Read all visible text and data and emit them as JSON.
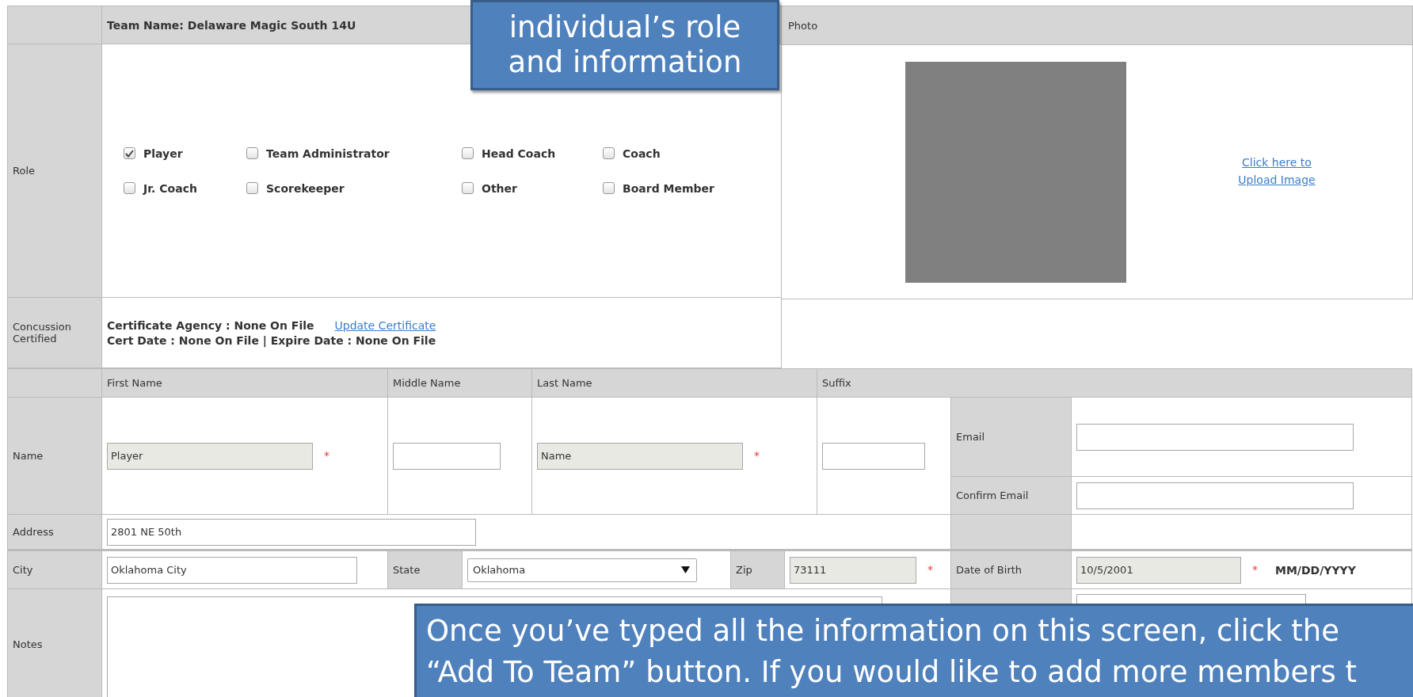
{
  "team_name": "Team Name: Delaware Magic South 14U",
  "role": {
    "label": "Role",
    "options": [
      {
        "label": "Player",
        "checked": true
      },
      {
        "label": "Team Administrator",
        "checked": false
      },
      {
        "label": "Head Coach",
        "checked": false
      },
      {
        "label": "Coach",
        "checked": false
      },
      {
        "label": "Jr. Coach",
        "checked": false
      },
      {
        "label": "Scorekeeper",
        "checked": false
      },
      {
        "label": "Other",
        "checked": false
      },
      {
        "label": "Board Member",
        "checked": false
      }
    ]
  },
  "concussion": {
    "label": "Concussion Certified",
    "agency": "Certificate Agency : None On File",
    "update_link": "Update Certificate",
    "dates": "Cert Date : None On File | Expire Date : None On File"
  },
  "photo": {
    "heading": "Photo",
    "upload_link": "Click here to Upload Image"
  },
  "name_columns": [
    "First Name",
    "Middle Name",
    "Last Name",
    "Suffix"
  ],
  "name": {
    "label": "Name",
    "fields": [
      {
        "value": "Player",
        "required": true
      },
      {
        "required": false
      },
      {
        "value": "Name",
        "required": true
      },
      {
        "required": false
      }
    ]
  },
  "email": {
    "label": "Email"
  },
  "confirm_email": {
    "label": "Confirm Email"
  },
  "address": {
    "label": "Address",
    "value": "2801 NE 50th"
  },
  "city": {
    "label": "City",
    "value": "Oklahoma City"
  },
  "state": {
    "label": "State",
    "value": "Oklahoma"
  },
  "zip": {
    "label": "Zip",
    "value": "73111",
    "required": true
  },
  "dob": {
    "label": "Date of Birth",
    "value": "10/5/2001",
    "required": true,
    "format": "MM/DD/YYYY"
  },
  "notes": {
    "label": "Notes"
  },
  "required_symbol": "*",
  "callouts": [
    {
      "lines": [
        "individual’s role",
        "and information"
      ]
    },
    {
      "lines": [
        "Once  you’ve typed all the information on this screen, click the",
        "“Add To Team” button. If you would like to add more members t"
      ]
    }
  ]
}
